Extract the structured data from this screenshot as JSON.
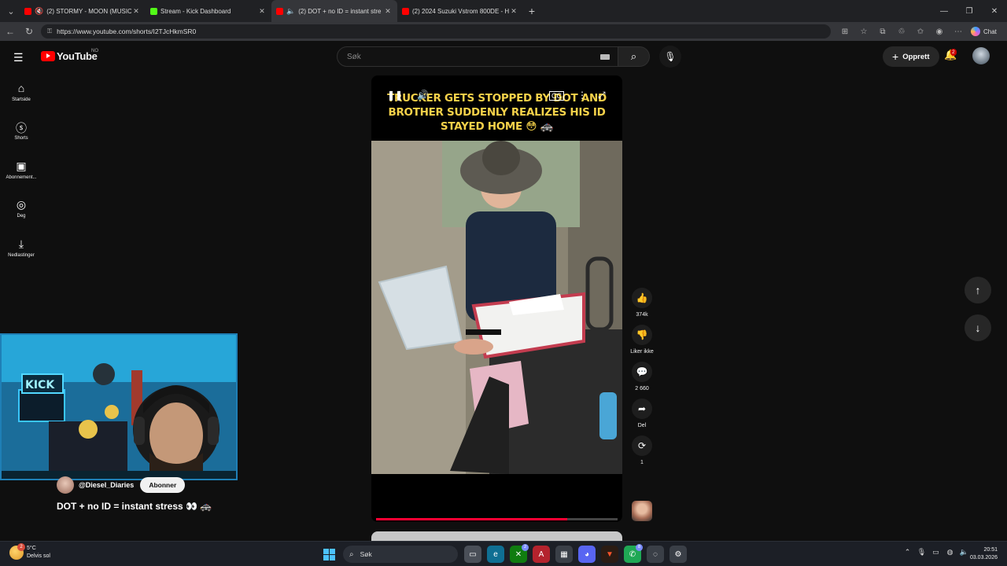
{
  "browser": {
    "tabs": [
      {
        "title": "(2) STORMY - MOON (MUSIC",
        "color": "#ff0000",
        "muted_icon": "speaker-muted-icon"
      },
      {
        "title": "Stream - Kick Dashboard",
        "color": "#53fc18"
      },
      {
        "title": "(2) DOT + no ID = instant stre",
        "color": "#ff0000",
        "active": true
      },
      {
        "title": "(2) 2024 Suzuki Vstrom 800DE - H",
        "color": "#ff0000"
      }
    ],
    "url": "https://www.youtube.com/shorts/I2TJcHkmSR0",
    "chat_label": "Chat"
  },
  "youtube": {
    "logo_text": "YouTube",
    "region": "NO",
    "search_placeholder": "Søk",
    "create_label": "Opprett",
    "notification_count": "2"
  },
  "sidebar": {
    "items": [
      {
        "label": "Startside",
        "icon": "home-icon"
      },
      {
        "label": "Shorts",
        "icon": "shorts-icon"
      },
      {
        "label": "Abonnement...",
        "icon": "subscriptions-icon"
      },
      {
        "label": "Deg",
        "icon": "you-icon"
      },
      {
        "label": "Nedlastinger",
        "icon": "download-icon"
      }
    ]
  },
  "short": {
    "caption": "TRUCKER GETS STOPPED BY DOT AND BROTHER SUDDENLY REALIZES HIS ID STAYED HOME 😳 🚓",
    "progress": 0.79,
    "channel": "@Diesel_Diaries",
    "subscribe_label": "Abonner",
    "title": "DOT + no ID = instant stress 👀 🚓",
    "actions": {
      "likes": "374k",
      "dislike_label": "Liker ikke",
      "comments": "2 660",
      "share_label": "Del",
      "remix_count": "1"
    }
  },
  "taskbar": {
    "weather_temp": "5°C",
    "weather_desc": "Delvis sol",
    "weather_badge": "2",
    "search_label": "Søk",
    "time": "20:51",
    "date": "03.03.2026"
  }
}
